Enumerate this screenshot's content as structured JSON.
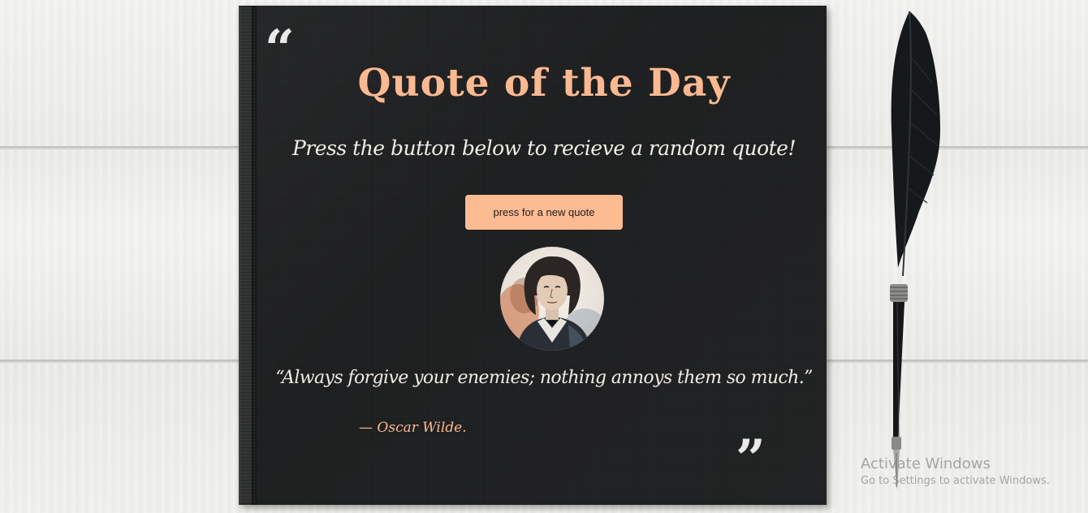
{
  "app": {
    "title": "Quote of the Day",
    "subtitle": "Press the button below to recieve a random quote!",
    "button_label": "press for a new quote",
    "open_quote_glyph": "“",
    "close_quote_glyph": "”"
  },
  "quote": {
    "text": "“Always forgive your enemies; nothing annoys them so much.”",
    "author": "— Oscar Wilde.",
    "portrait_icon": "author-portrait"
  },
  "colors": {
    "accent": "#fbb991",
    "button": "#fdbb92",
    "book": "#1f2021",
    "text": "#f1ece6"
  },
  "watermark": {
    "title": "Activate Windows",
    "subtitle": "Go to Settings to activate Windows."
  }
}
